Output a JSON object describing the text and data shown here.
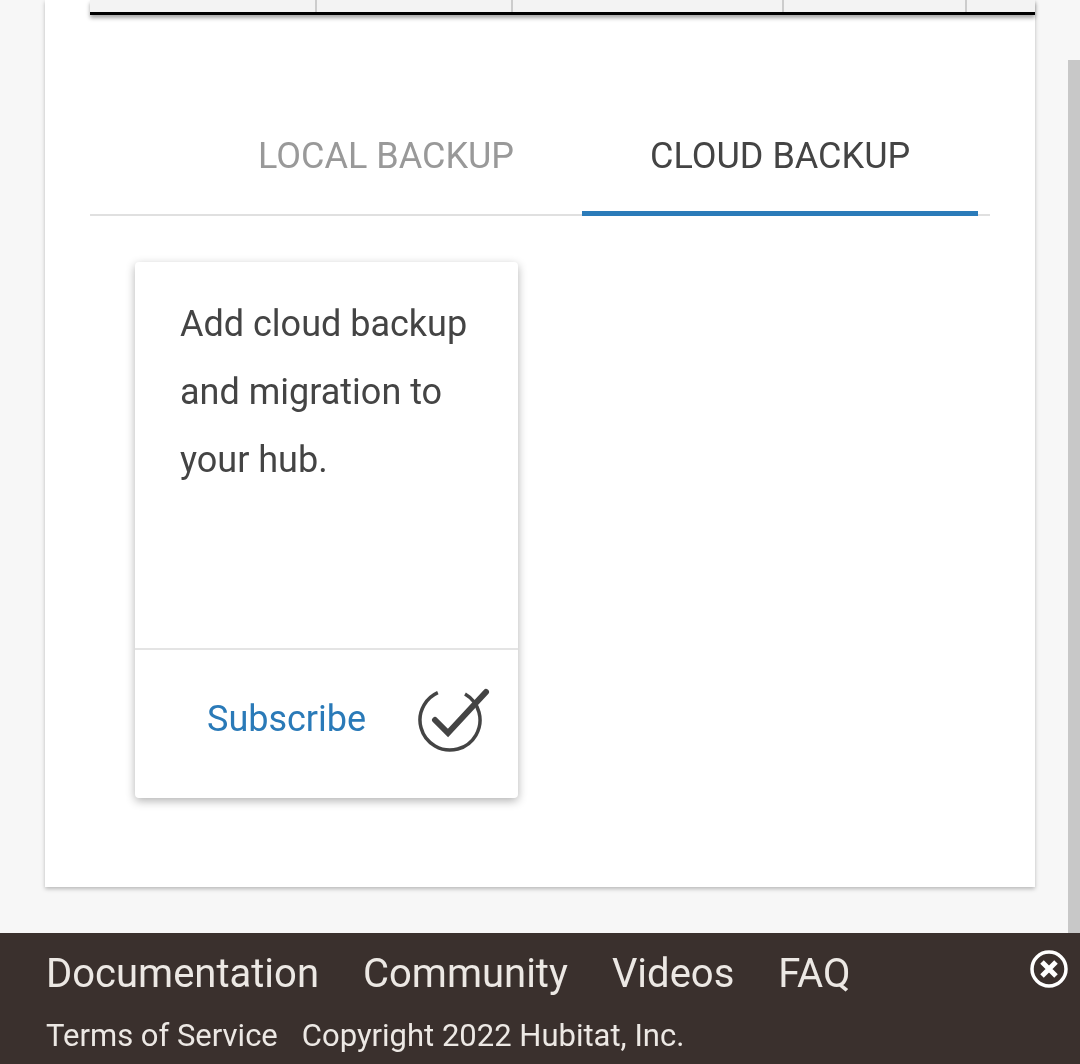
{
  "tabs": [
    {
      "label": "LOCAL BACKUP",
      "selected": false
    },
    {
      "label": "CLOUD BACKUP",
      "selected": true
    }
  ],
  "plan_card": {
    "description": "Add cloud backup and migration to your hub.",
    "action": "Subscribe"
  },
  "footer": {
    "links": [
      "Documentation",
      "Community",
      "Videos",
      "FAQ"
    ],
    "terms": "Terms of Service",
    "copyright": "Copyright 2022 Hubitat, Inc."
  }
}
